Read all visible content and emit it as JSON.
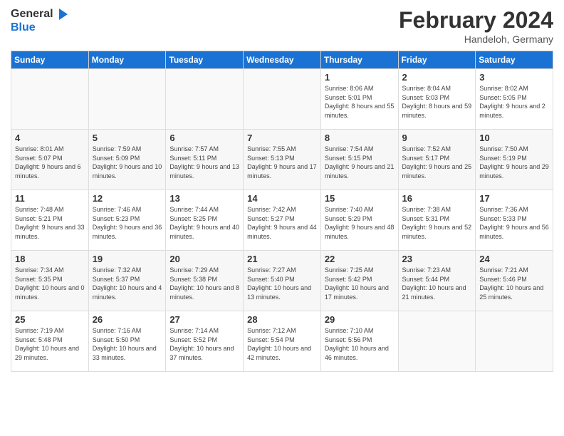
{
  "header": {
    "logo_general": "General",
    "logo_blue": "Blue",
    "month_year": "February 2024",
    "location": "Handeloh, Germany"
  },
  "days_of_week": [
    "Sunday",
    "Monday",
    "Tuesday",
    "Wednesday",
    "Thursday",
    "Friday",
    "Saturday"
  ],
  "weeks": [
    [
      {
        "day": "",
        "sunrise": "",
        "sunset": "",
        "daylight": "",
        "empty": true
      },
      {
        "day": "",
        "sunrise": "",
        "sunset": "",
        "daylight": "",
        "empty": true
      },
      {
        "day": "",
        "sunrise": "",
        "sunset": "",
        "daylight": "",
        "empty": true
      },
      {
        "day": "",
        "sunrise": "",
        "sunset": "",
        "daylight": "",
        "empty": true
      },
      {
        "day": "1",
        "sunrise": "Sunrise: 8:06 AM",
        "sunset": "Sunset: 5:01 PM",
        "daylight": "Daylight: 8 hours and 55 minutes.",
        "empty": false
      },
      {
        "day": "2",
        "sunrise": "Sunrise: 8:04 AM",
        "sunset": "Sunset: 5:03 PM",
        "daylight": "Daylight: 8 hours and 59 minutes.",
        "empty": false
      },
      {
        "day": "3",
        "sunrise": "Sunrise: 8:02 AM",
        "sunset": "Sunset: 5:05 PM",
        "daylight": "Daylight: 9 hours and 2 minutes.",
        "empty": false
      }
    ],
    [
      {
        "day": "4",
        "sunrise": "Sunrise: 8:01 AM",
        "sunset": "Sunset: 5:07 PM",
        "daylight": "Daylight: 9 hours and 6 minutes.",
        "empty": false
      },
      {
        "day": "5",
        "sunrise": "Sunrise: 7:59 AM",
        "sunset": "Sunset: 5:09 PM",
        "daylight": "Daylight: 9 hours and 10 minutes.",
        "empty": false
      },
      {
        "day": "6",
        "sunrise": "Sunrise: 7:57 AM",
        "sunset": "Sunset: 5:11 PM",
        "daylight": "Daylight: 9 hours and 13 minutes.",
        "empty": false
      },
      {
        "day": "7",
        "sunrise": "Sunrise: 7:55 AM",
        "sunset": "Sunset: 5:13 PM",
        "daylight": "Daylight: 9 hours and 17 minutes.",
        "empty": false
      },
      {
        "day": "8",
        "sunrise": "Sunrise: 7:54 AM",
        "sunset": "Sunset: 5:15 PM",
        "daylight": "Daylight: 9 hours and 21 minutes.",
        "empty": false
      },
      {
        "day": "9",
        "sunrise": "Sunrise: 7:52 AM",
        "sunset": "Sunset: 5:17 PM",
        "daylight": "Daylight: 9 hours and 25 minutes.",
        "empty": false
      },
      {
        "day": "10",
        "sunrise": "Sunrise: 7:50 AM",
        "sunset": "Sunset: 5:19 PM",
        "daylight": "Daylight: 9 hours and 29 minutes.",
        "empty": false
      }
    ],
    [
      {
        "day": "11",
        "sunrise": "Sunrise: 7:48 AM",
        "sunset": "Sunset: 5:21 PM",
        "daylight": "Daylight: 9 hours and 33 minutes.",
        "empty": false
      },
      {
        "day": "12",
        "sunrise": "Sunrise: 7:46 AM",
        "sunset": "Sunset: 5:23 PM",
        "daylight": "Daylight: 9 hours and 36 minutes.",
        "empty": false
      },
      {
        "day": "13",
        "sunrise": "Sunrise: 7:44 AM",
        "sunset": "Sunset: 5:25 PM",
        "daylight": "Daylight: 9 hours and 40 minutes.",
        "empty": false
      },
      {
        "day": "14",
        "sunrise": "Sunrise: 7:42 AM",
        "sunset": "Sunset: 5:27 PM",
        "daylight": "Daylight: 9 hours and 44 minutes.",
        "empty": false
      },
      {
        "day": "15",
        "sunrise": "Sunrise: 7:40 AM",
        "sunset": "Sunset: 5:29 PM",
        "daylight": "Daylight: 9 hours and 48 minutes.",
        "empty": false
      },
      {
        "day": "16",
        "sunrise": "Sunrise: 7:38 AM",
        "sunset": "Sunset: 5:31 PM",
        "daylight": "Daylight: 9 hours and 52 minutes.",
        "empty": false
      },
      {
        "day": "17",
        "sunrise": "Sunrise: 7:36 AM",
        "sunset": "Sunset: 5:33 PM",
        "daylight": "Daylight: 9 hours and 56 minutes.",
        "empty": false
      }
    ],
    [
      {
        "day": "18",
        "sunrise": "Sunrise: 7:34 AM",
        "sunset": "Sunset: 5:35 PM",
        "daylight": "Daylight: 10 hours and 0 minutes.",
        "empty": false
      },
      {
        "day": "19",
        "sunrise": "Sunrise: 7:32 AM",
        "sunset": "Sunset: 5:37 PM",
        "daylight": "Daylight: 10 hours and 4 minutes.",
        "empty": false
      },
      {
        "day": "20",
        "sunrise": "Sunrise: 7:29 AM",
        "sunset": "Sunset: 5:38 PM",
        "daylight": "Daylight: 10 hours and 8 minutes.",
        "empty": false
      },
      {
        "day": "21",
        "sunrise": "Sunrise: 7:27 AM",
        "sunset": "Sunset: 5:40 PM",
        "daylight": "Daylight: 10 hours and 13 minutes.",
        "empty": false
      },
      {
        "day": "22",
        "sunrise": "Sunrise: 7:25 AM",
        "sunset": "Sunset: 5:42 PM",
        "daylight": "Daylight: 10 hours and 17 minutes.",
        "empty": false
      },
      {
        "day": "23",
        "sunrise": "Sunrise: 7:23 AM",
        "sunset": "Sunset: 5:44 PM",
        "daylight": "Daylight: 10 hours and 21 minutes.",
        "empty": false
      },
      {
        "day": "24",
        "sunrise": "Sunrise: 7:21 AM",
        "sunset": "Sunset: 5:46 PM",
        "daylight": "Daylight: 10 hours and 25 minutes.",
        "empty": false
      }
    ],
    [
      {
        "day": "25",
        "sunrise": "Sunrise: 7:19 AM",
        "sunset": "Sunset: 5:48 PM",
        "daylight": "Daylight: 10 hours and 29 minutes.",
        "empty": false
      },
      {
        "day": "26",
        "sunrise": "Sunrise: 7:16 AM",
        "sunset": "Sunset: 5:50 PM",
        "daylight": "Daylight: 10 hours and 33 minutes.",
        "empty": false
      },
      {
        "day": "27",
        "sunrise": "Sunrise: 7:14 AM",
        "sunset": "Sunset: 5:52 PM",
        "daylight": "Daylight: 10 hours and 37 minutes.",
        "empty": false
      },
      {
        "day": "28",
        "sunrise": "Sunrise: 7:12 AM",
        "sunset": "Sunset: 5:54 PM",
        "daylight": "Daylight: 10 hours and 42 minutes.",
        "empty": false
      },
      {
        "day": "29",
        "sunrise": "Sunrise: 7:10 AM",
        "sunset": "Sunset: 5:56 PM",
        "daylight": "Daylight: 10 hours and 46 minutes.",
        "empty": false
      },
      {
        "day": "",
        "sunrise": "",
        "sunset": "",
        "daylight": "",
        "empty": true
      },
      {
        "day": "",
        "sunrise": "",
        "sunset": "",
        "daylight": "",
        "empty": true
      }
    ]
  ]
}
